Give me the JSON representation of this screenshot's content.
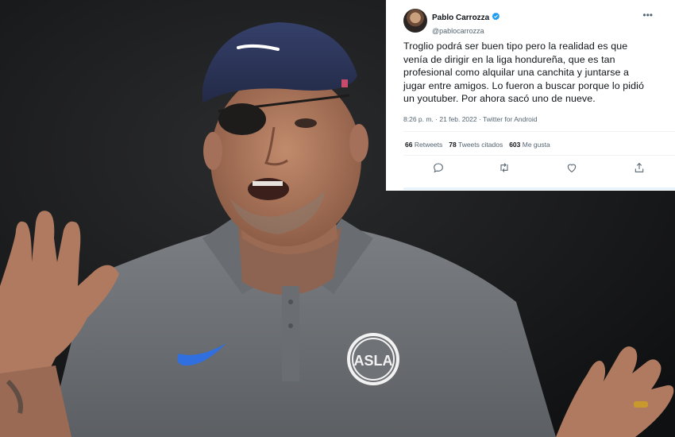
{
  "tweet": {
    "author_name": "Pablo Carrozza",
    "author_handle": "@pablocarrozza",
    "text_lines": [
      "Troglio podrá ser buen tipo pero la realidad es que",
      "venía de dirigir en la liga hondureña, que es tan",
      "profesional como alquilar una canchita y juntarse a",
      "jugar entre amigos. Lo fueron a buscar porque lo pidió",
      "un youtuber. Por ahora sacó uno de nueve."
    ],
    "meta": "8:26 p. m. · 21 feb. 2022 · Twitter for Android",
    "stats": {
      "retweets_count": "66",
      "retweets_label": "Retweets",
      "quotes_count": "78",
      "quotes_label": "Tweets citados",
      "likes_count": "603",
      "likes_label": "Me gusta"
    },
    "icons": {
      "more": "more-icon",
      "verified": "verified-badge-icon",
      "reply": "reply-icon",
      "retweet": "retweet-icon",
      "like": "like-icon",
      "share": "share-icon"
    },
    "colors": {
      "verified": "#1d9bf0",
      "text": "#0f1419",
      "muted": "#536471"
    }
  },
  "photo": {
    "badge_text": "ASLA",
    "cap_color": "#2c3558",
    "shirt_color": "#6f7276"
  }
}
